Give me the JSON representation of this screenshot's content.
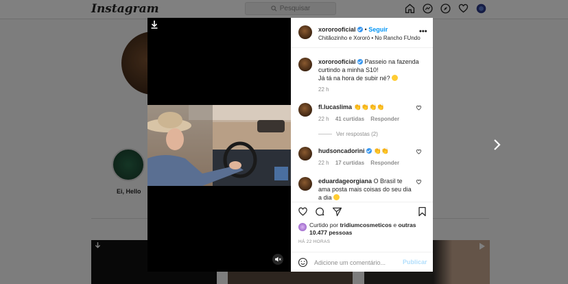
{
  "app": {
    "logo": "Instagram"
  },
  "topbar": {
    "search_placeholder": "Pesquisar",
    "icons": [
      "home-icon",
      "messenger-icon",
      "explore-icon",
      "activity-heart-icon",
      "profile-avatar-icon"
    ]
  },
  "profile": {
    "highlight_label": "Ei, Hello"
  },
  "post": {
    "header": {
      "username": "xororooficial",
      "separator": "•",
      "follow_label": "Seguir",
      "subtitle": "Chitãozinho e Xororó • No Rancho FUndo"
    },
    "caption": {
      "username": "xororooficial",
      "text_line1": "Passeio na fazenda curtindo a minha S10!",
      "text_line2": "Já tá na hora de subir né?",
      "time": "22 h"
    },
    "comments": [
      {
        "username": "fl.lucaslima",
        "text": "👏👏👏👏",
        "time": "22 h",
        "likes": "41 curtidas",
        "reply_label": "Responder",
        "view_replies": "Ver respostas (2)"
      },
      {
        "username": "hudsoncadorini",
        "text": "👏👏",
        "time": "22 h",
        "likes": "17 curtidas",
        "reply_label": "Responder"
      },
      {
        "username": "eduardageorgiana",
        "text": "O Brasil te ama posta mais coisas do seu dia a dia"
      }
    ],
    "liked_by": {
      "prefix": "Curtido por",
      "user": "tridiumcosmeticos",
      "middle": "e",
      "others": "outras 10.477 pessoas"
    },
    "timestamp": "HÁ 22 HORAS",
    "comment_box": {
      "placeholder": "Adicione um comentário...",
      "post_label": "Publicar"
    }
  },
  "colors": {
    "accent": "#0095f6",
    "verified": "#3897f0",
    "post_disabled": "#b2dffc",
    "muted_text": "#8e8e8e"
  }
}
